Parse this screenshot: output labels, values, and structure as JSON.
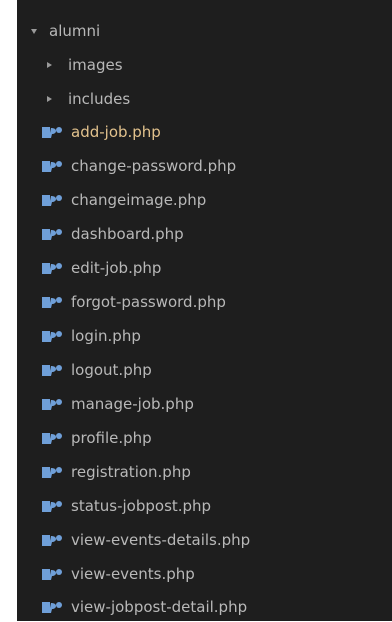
{
  "explorer": {
    "root": {
      "label": "alumni",
      "icon": "chevron-down-icon"
    },
    "folders": [
      {
        "label": "images",
        "icon": "chevron-right-icon"
      },
      {
        "label": "includes",
        "icon": "chevron-right-icon"
      }
    ],
    "files": [
      {
        "label": "add-job.php",
        "icon": "php-file-icon",
        "active": true
      },
      {
        "label": "change-password.php",
        "icon": "php-file-icon"
      },
      {
        "label": "changeimage.php",
        "icon": "php-file-icon"
      },
      {
        "label": "dashboard.php",
        "icon": "php-file-icon"
      },
      {
        "label": "edit-job.php",
        "icon": "php-file-icon"
      },
      {
        "label": "forgot-password.php",
        "icon": "php-file-icon"
      },
      {
        "label": "login.php",
        "icon": "php-file-icon"
      },
      {
        "label": "logout.php",
        "icon": "php-file-icon"
      },
      {
        "label": "manage-job.php",
        "icon": "php-file-icon"
      },
      {
        "label": "profile.php",
        "icon": "php-file-icon"
      },
      {
        "label": "registration.php",
        "icon": "php-file-icon"
      },
      {
        "label": "status-jobpost.php",
        "icon": "php-file-icon"
      },
      {
        "label": "view-events-details.php",
        "icon": "php-file-icon"
      },
      {
        "label": "view-events.php",
        "icon": "php-file-icon"
      },
      {
        "label": "view-jobpost-detail.php",
        "icon": "php-file-icon"
      }
    ],
    "colors": {
      "background": "#1e1e1e",
      "text": "#b8b8b8",
      "active_text": "#e2c28d",
      "php_icon": "#6f9fd8"
    }
  }
}
